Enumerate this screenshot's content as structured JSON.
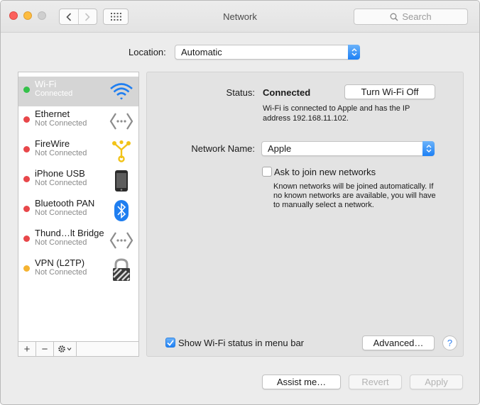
{
  "window": {
    "title": "Network"
  },
  "search": {
    "placeholder": "Search"
  },
  "location": {
    "label": "Location:",
    "value": "Automatic"
  },
  "services": [
    {
      "name": "Wi-Fi",
      "status": "Connected",
      "dot_color": "#35c14a",
      "icon": "wifi-icon",
      "selected": true
    },
    {
      "name": "Ethernet",
      "status": "Not Connected",
      "dot_color": "#e8474a",
      "icon": "ethernet-icon"
    },
    {
      "name": "FireWire",
      "status": "Not Connected",
      "dot_color": "#e8474a",
      "icon": "firewire-icon"
    },
    {
      "name": "iPhone USB",
      "status": "Not Connected",
      "dot_color": "#e8474a",
      "icon": "iphone-icon"
    },
    {
      "name": "Bluetooth PAN",
      "status": "Not Connected",
      "dot_color": "#e8474a",
      "icon": "bluetooth-icon"
    },
    {
      "name": "Thund…lt Bridge",
      "status": "Not Connected",
      "dot_color": "#e8474a",
      "icon": "thunderbolt-bridge-icon"
    },
    {
      "name": "VPN (L2TP)",
      "status": "Not Connected",
      "dot_color": "#f5b331",
      "icon": "vpn-lock-icon"
    }
  ],
  "detail": {
    "status_label": "Status:",
    "status_value": "Connected",
    "turn_off_label": "Turn Wi-Fi Off",
    "status_desc_line1": "Wi-Fi is connected to Apple and has the IP",
    "status_desc_line2": "address 192.168.11.102.",
    "network_name_label": "Network Name:",
    "network_name_value": "Apple",
    "ask_join_label": "Ask to join new networks",
    "ask_join_checked": false,
    "ask_desc_line1": "Known networks will be joined automatically. If",
    "ask_desc_line2": "no known networks are available, you will have",
    "ask_desc_line3": "to manually select a network.",
    "show_status_label": "Show Wi-Fi status in menu bar",
    "show_status_checked": true,
    "advanced_label": "Advanced…",
    "help_label": "?"
  },
  "sidebar_tools": {
    "add": "+",
    "remove": "−"
  },
  "footer": {
    "assist_label": "Assist me…",
    "revert_label": "Revert",
    "apply_label": "Apply"
  },
  "colors": {
    "accent": "#1d80f5",
    "selected_row": "#d5d5d5"
  }
}
